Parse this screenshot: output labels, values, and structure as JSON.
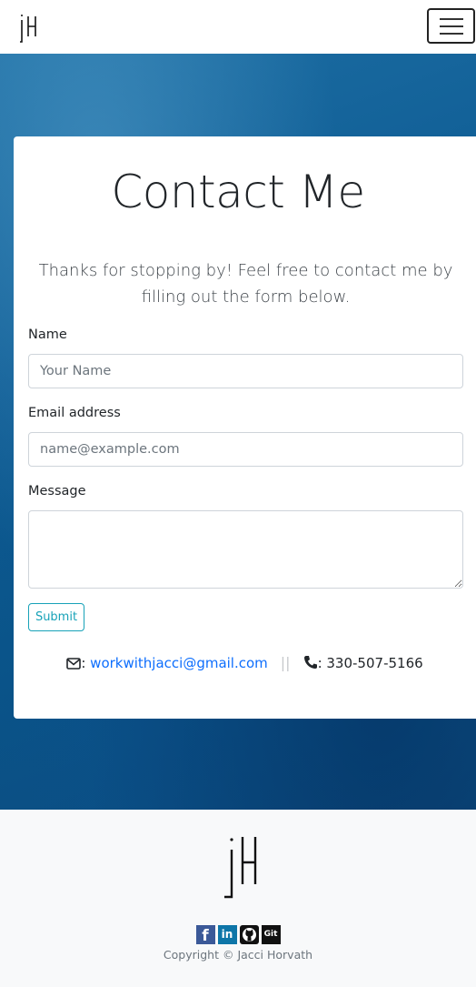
{
  "nav": {
    "logo_alt": "jH logo",
    "toggle_label": "Toggle navigation"
  },
  "contact": {
    "title": "Contact Me",
    "intro": "Thanks for stopping by! Feel free to contact me by filling out the form below.",
    "name_label": "Name",
    "name_placeholder": "Your Name",
    "email_label": "Email address",
    "email_placeholder": "name@example.com",
    "message_label": "Message",
    "message_value": "",
    "submit_label": "Submit",
    "email_sep": ": ",
    "email": "workwithjacci@gmail.com",
    "phone_sep": ": ",
    "phone": "330-507-5166",
    "divider": "||"
  },
  "footer": {
    "socials": [
      {
        "name": "facebook-icon",
        "glyph": "f"
      },
      {
        "name": "linkedin-icon",
        "glyph": "in"
      },
      {
        "name": "github-icon",
        "glyph": ""
      },
      {
        "name": "git-icon",
        "glyph": "Git"
      }
    ],
    "copyright": "Copyright © Jacci Horvath"
  },
  "colors": {
    "accent": "#17a2b8",
    "link": "#0d6efd",
    "hero_blue": "#0f5d95"
  }
}
